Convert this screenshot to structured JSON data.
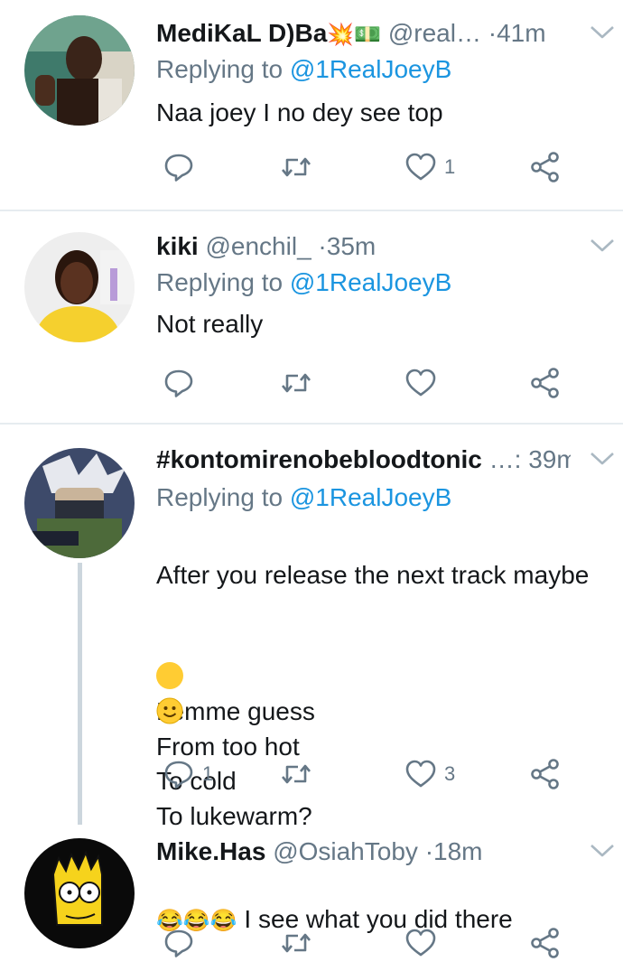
{
  "tweets": [
    {
      "name": "MediKaL D)Ba",
      "name_emojis": "💥💵",
      "handle": "@real…",
      "dot": "·",
      "time": "41m",
      "reply_prefix": "Replying to",
      "reply_to": "@1RealJoeyB",
      "text": "Naa joey I no dey see top",
      "reply_count": "",
      "retweet_count": "",
      "like_count": "1"
    },
    {
      "name": "kiki",
      "handle": "@enchil_",
      "dot": "·",
      "time": "35m",
      "reply_prefix": "Replying to",
      "reply_to": "@1RealJoeyB",
      "text": "Not really",
      "reply_count": "",
      "retweet_count": "",
      "like_count": ""
    },
    {
      "name": "#kontomirenobebloodtonic",
      "name_suffix": "…:",
      "time": "39m",
      "reply_prefix": "Replying to",
      "reply_to": "@1RealJoeyB",
      "text_line1": "After you release the next track maybe",
      "text_rest": "Lemme guess\nFrom too hot\nTo cold\nTo lukewarm?",
      "reply_count": "1",
      "retweet_count": "",
      "like_count": "3"
    },
    {
      "name": "Mike.Has",
      "handle": "@OsiahToby",
      "dot": "·",
      "time": "18m",
      "text_emojis": "😂😂😂",
      "text": " I see what you did there",
      "reply_count": "",
      "retweet_count": "",
      "like_count": ""
    }
  ],
  "icons": {
    "reply": "reply-icon",
    "retweet": "retweet-icon",
    "like": "heart-icon",
    "share": "share-icon",
    "more": "chevron-down-icon"
  },
  "colors": {
    "text": "#14171a",
    "secondary": "#657786",
    "link": "#1b95e0",
    "divider": "#e6ecf0"
  }
}
